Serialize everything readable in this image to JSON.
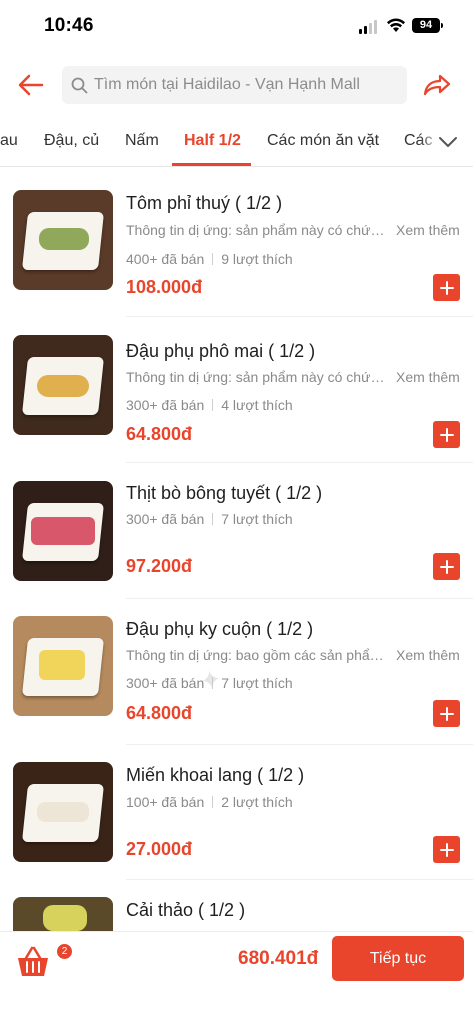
{
  "status_bar": {
    "time": "10:46",
    "battery": "94"
  },
  "search": {
    "placeholder": "Tìm món tại Haidilao - Vạn Hạnh Mall"
  },
  "tabs": [
    {
      "label": "au"
    },
    {
      "label": "Đậu, củ"
    },
    {
      "label": "Nấm"
    },
    {
      "label": "Half 1/2"
    },
    {
      "label": "Các món ăn vặt"
    },
    {
      "label": "Các"
    }
  ],
  "active_tab": "Half 1/2",
  "items": [
    {
      "name": "Tôm phỉ thuý ( 1/2 )",
      "allergy": "Thông tin dị ứng: sản phẩm này có chứa tôm",
      "see_more": "Xem thêm",
      "sold": "400+ đã bán",
      "likes": "9 lượt thích",
      "price": "108.000đ"
    },
    {
      "name": "Đậu phụ phô mai ( 1/2 )",
      "allergy": "Thông tin dị ứng: sản phẩm này có chứa sữa",
      "see_more": "Xem thêm",
      "sold": "300+ đã bán",
      "likes": "4 lượt thích",
      "price": "64.800đ"
    },
    {
      "name": "Thịt bò bông tuyết ( 1/2 )",
      "allergy": "",
      "see_more": "",
      "sold": "300+ đã bán",
      "likes": "7 lượt thích",
      "price": "97.200đ"
    },
    {
      "name": "Đậu phụ ky cuộn ( 1/2 )",
      "allergy": "Thông tin dị ứng: bao gồm các sản phẩm từ đậu nành",
      "see_more": "Xem thêm",
      "sold": "300+ đã bán",
      "likes": "7 lượt thích",
      "price": "64.800đ"
    },
    {
      "name": "Miến khoai lang ( 1/2 )",
      "allergy": "",
      "see_more": "",
      "sold": "100+ đã bán",
      "likes": "2 lượt thích",
      "price": "27.000đ"
    },
    {
      "name": "Cải thảo ( 1/2 )",
      "allergy": "",
      "see_more": "",
      "sold": "",
      "likes": "",
      "price": ""
    }
  ],
  "cart": {
    "count": "2",
    "total": "680.401đ",
    "continue_label": "Tiếp tục"
  },
  "colors": {
    "accent": "#e8452c"
  },
  "icons": [
    "back-arrow-icon",
    "search-icon",
    "share-icon",
    "chevron-down-icon",
    "plus-icon",
    "cart-basket-icon"
  ]
}
